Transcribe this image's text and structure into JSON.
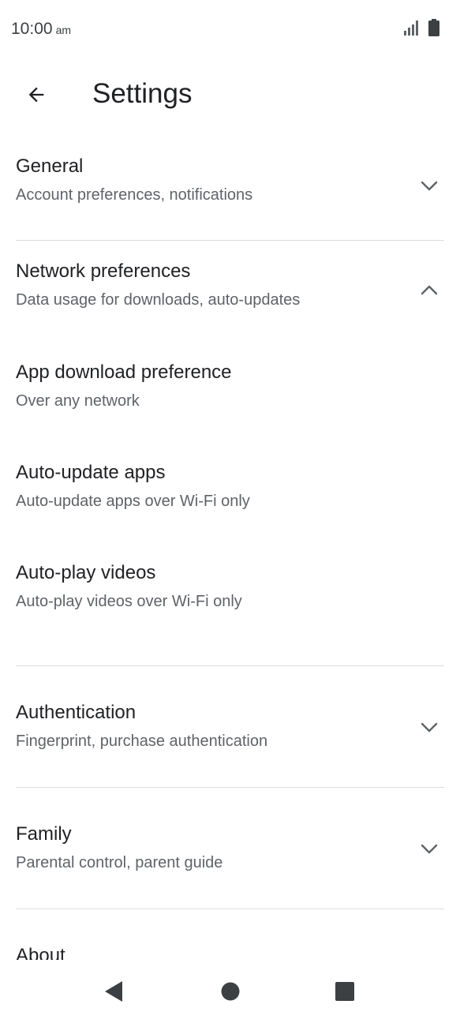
{
  "status_bar": {
    "time": "10:00",
    "ampm": "am"
  },
  "app_bar": {
    "title": "Settings"
  },
  "sections": [
    {
      "title": "General",
      "subtitle": "Account preferences, notifications",
      "expanded": false
    },
    {
      "title": "Network preferences",
      "subtitle": "Data usage for downloads, auto-updates",
      "expanded": true,
      "items": [
        {
          "title": "App download preference",
          "subtitle": "Over any network"
        },
        {
          "title": "Auto-update apps",
          "subtitle": "Auto-update apps over Wi-Fi only"
        },
        {
          "title": "Auto-play videos",
          "subtitle": "Auto-play videos over Wi-Fi only"
        }
      ]
    },
    {
      "title": "Authentication",
      "subtitle": "Fingerprint, purchase authentication",
      "expanded": false
    },
    {
      "title": "Family",
      "subtitle": "Parental control, parent guide",
      "expanded": false
    },
    {
      "title": "About",
      "subtitle": "",
      "expanded": false
    }
  ],
  "colors": {
    "text_primary": "#202124",
    "text_secondary": "#5f6368",
    "divider": "#dadce0",
    "icon": "#5f6368"
  },
  "icons": [
    "back-arrow-icon",
    "chevron-down-icon",
    "chevron-up-icon",
    "signal-icon",
    "battery-icon",
    "nav-back-icon",
    "nav-home-icon",
    "nav-recents-icon"
  ]
}
